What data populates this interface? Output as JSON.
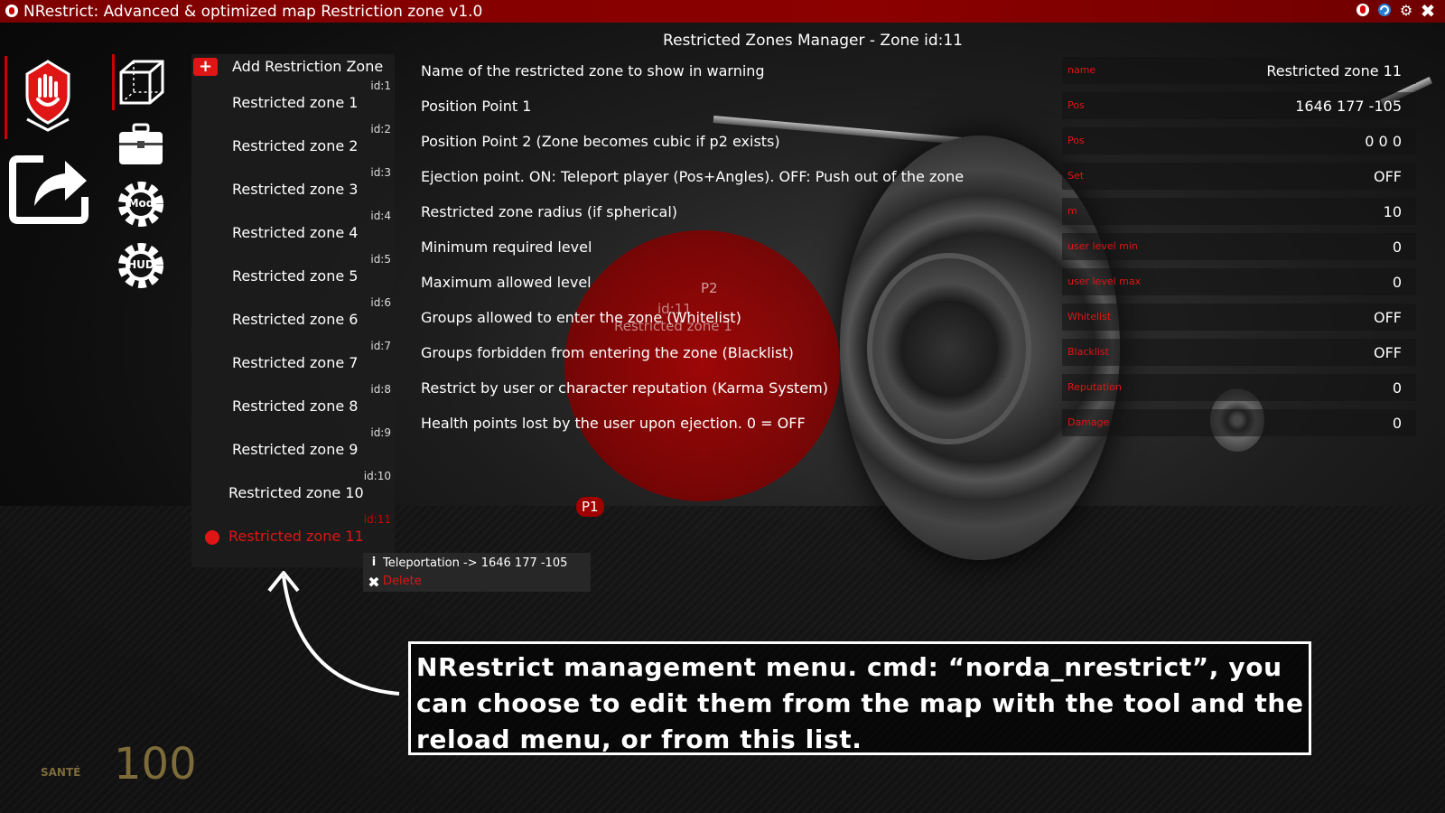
{
  "window": {
    "title": "NRestrict: Advanced & optimized map Restriction zone v1.0",
    "controls": [
      "nrestrict-icon",
      "refresh-icon",
      "gear-icon",
      "close-icon"
    ]
  },
  "left_icons": [
    "hand-stop-icon",
    "share-icon"
  ],
  "tool_icons": [
    {
      "name": "cube-icon"
    },
    {
      "name": "briefcase-icon"
    },
    {
      "name": "mod-gear-icon",
      "label": "Mod"
    },
    {
      "name": "hud-gear-icon",
      "label": "HUD"
    }
  ],
  "zone_list": {
    "add_label": "Add Restriction Zone",
    "items": [
      {
        "id": "id:1",
        "name": "Restricted zone 1"
      },
      {
        "id": "id:2",
        "name": "Restricted zone 2"
      },
      {
        "id": "id:3",
        "name": "Restricted zone 3"
      },
      {
        "id": "id:4",
        "name": "Restricted zone 4"
      },
      {
        "id": "id:5",
        "name": "Restricted zone 5"
      },
      {
        "id": "id:6",
        "name": "Restricted zone 6"
      },
      {
        "id": "id:7",
        "name": "Restricted zone 7"
      },
      {
        "id": "id:8",
        "name": "Restricted zone 8"
      },
      {
        "id": "id:9",
        "name": "Restricted zone 9"
      },
      {
        "id": "id:10",
        "name": "Restricted zone 10"
      },
      {
        "id": "id:11",
        "name": "Restricted zone 11",
        "selected": true
      }
    ]
  },
  "context_menu": {
    "info": "Teleportation -> 1646 177 -105",
    "delete": "Delete"
  },
  "manager": {
    "title": "Restricted Zones Manager - Zone id:11",
    "settings": [
      {
        "label": "Name of the restricted zone to show in warning",
        "hint": "name",
        "value": "Restricted zone 11"
      },
      {
        "label": "Position Point 1",
        "hint": "Pos",
        "value": "1646 177 -105"
      },
      {
        "label": "Position Point 2 (Zone becomes cubic if p2 exists)",
        "hint": "Pos",
        "value": "0 0 0"
      },
      {
        "label": "Ejection point. ON: Teleport player (Pos+Angles). OFF: Push out of the zone",
        "hint": "Set",
        "value": "OFF"
      },
      {
        "label": "Restricted zone radius (if spherical)",
        "hint": "m",
        "value": "10"
      },
      {
        "label": "Minimum required level",
        "hint": "user level min",
        "value": "0"
      },
      {
        "label": "Maximum allowed level",
        "hint": "user level max",
        "value": "0"
      },
      {
        "label": "Groups allowed to enter the zone (Whitelist)",
        "hint": "Whitelist",
        "value": "OFF"
      },
      {
        "label": "Groups forbidden from entering the zone (Blacklist)",
        "hint": "Blacklist",
        "value": "OFF"
      },
      {
        "label": "Restrict by user or character reputation (Karma System)",
        "hint": "Reputation",
        "value": "0"
      },
      {
        "label": "Health points lost by the user upon ejection. 0 = OFF",
        "hint": "Damage",
        "value": "0"
      }
    ]
  },
  "scene": {
    "p1": "P1",
    "p2": "P2",
    "zone_id": "id:11",
    "zone_name": "Restricted zone 1"
  },
  "callout": "NRestrict management menu. cmd: “norda_nrestrict”, you can choose to edit them from the map with the tool and the reload menu, or from this list.",
  "hud": {
    "label": "SANTÉ",
    "value": "100"
  },
  "colors": {
    "accent": "#e01515",
    "titlebar": "#8c0000",
    "hud": "#7d6b3a"
  }
}
